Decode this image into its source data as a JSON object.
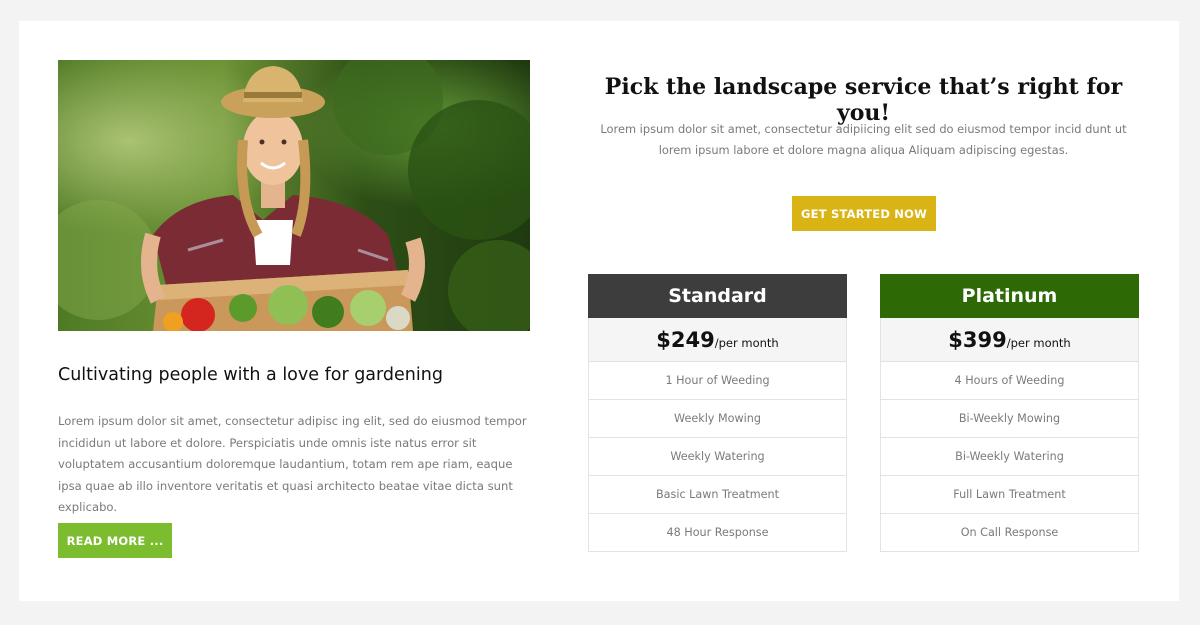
{
  "colors": {
    "page_background": "#f3f3f3",
    "card_background": "#ffffff",
    "read_more_button": "#7bbd2f",
    "get_started_button": "#dab414",
    "standard_header": "#3d3d3d",
    "platinum_header": "#2d6a06"
  },
  "left": {
    "image_icon": "woman-with-vegetable-crate-photo",
    "title": "Cultivating people with a love for gardening",
    "body": "Lorem ipsum dolor sit amet, consectetur adipisc ing elit, sed do eiusmod tempor incididun ut labore et dolore. Perspiciatis unde omnis iste natus error sit voluptatem accusantium doloremque laudantium, totam rem ape riam, eaque ipsa quae ab illo inventore veritatis et quasi architecto beatae vitae dicta sunt explicabo.",
    "read_more_label": "READ MORE ..."
  },
  "right": {
    "heading": "Pick the landscape service that’s right for you!",
    "subtext": "Lorem ipsum dolor sit amet, consectetur adipiicing elit sed do eiusmod tempor incid dunt ut lorem ipsum labore et dolore magna aliqua Aliquam adipiscing egestas.",
    "get_started_label": "GET STARTED NOW"
  },
  "plans": [
    {
      "name": "Standard",
      "price": "$249",
      "period": "/per month",
      "features": [
        "1 Hour of Weeding",
        "Weekly Mowing",
        "Weekly Watering",
        "Basic Lawn Treatment",
        "48 Hour Response"
      ]
    },
    {
      "name": "Platinum",
      "price": "$399",
      "period": "/per month",
      "features": [
        "4 Hours of Weeding",
        "Bi-Weekly Mowing",
        "Bi-Weekly Watering",
        "Full Lawn Treatment",
        "On Call Response"
      ]
    }
  ]
}
